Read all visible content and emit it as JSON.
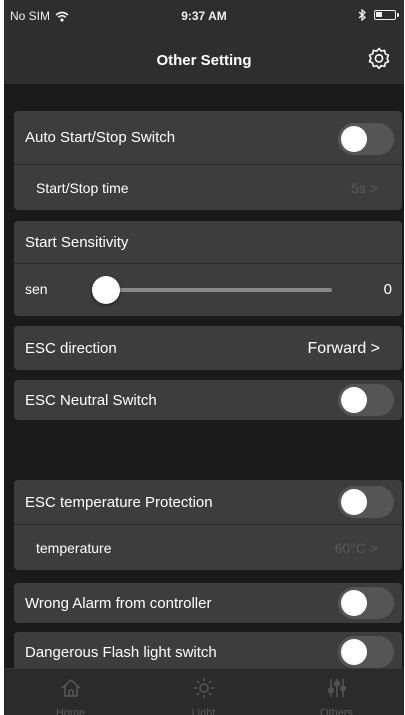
{
  "status_bar": {
    "carrier": "No SIM",
    "time": "9:37 AM",
    "battery_level": 0.35,
    "icons": [
      "wifi-icon",
      "bluetooth-icon",
      "battery-icon"
    ]
  },
  "nav": {
    "title": "Other Setting",
    "right_icon": "gear-icon"
  },
  "settings": {
    "auto_start_stop": {
      "label": "Auto Start/Stop Switch",
      "on": false
    },
    "start_stop_time": {
      "label": "Start/Stop time",
      "value": "5s >"
    },
    "start_sensitivity": {
      "label": "Start Sensitivity"
    },
    "sen": {
      "label": "sen",
      "value": "0",
      "level": 0.0
    },
    "esc_direction": {
      "label": "ESC direction",
      "value": "Forward >"
    },
    "esc_neutral": {
      "label": "ESC Neutral Switch",
      "on": false
    },
    "esc_temp_protection": {
      "label": "ESC temperature Protection",
      "on": false
    },
    "temperature": {
      "label": "temperature",
      "value": "60°C >"
    },
    "wrong_alarm": {
      "label": "Wrong Alarm from controller",
      "on": false
    },
    "danger_flash": {
      "label": "Dangerous Flash light switch",
      "on": false
    }
  },
  "tabs": [
    {
      "label": "Home",
      "icon": "home-icon"
    },
    {
      "label": "Light",
      "icon": "sun-icon"
    },
    {
      "label": "Others",
      "icon": "sliders-icon"
    }
  ],
  "colors": {
    "background": "#1a1a1a",
    "bar": "#2e2e2e",
    "row": "#3d3d3d",
    "toggle_off": "#555555",
    "dim_text": "#5a5a5a"
  }
}
